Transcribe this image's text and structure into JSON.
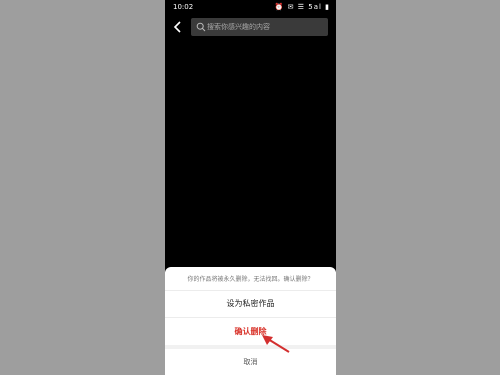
{
  "status_bar": {
    "time": "10:02",
    "icons_text": "⏰ ✉ ☰ 5al ▮"
  },
  "nav": {
    "back_icon": "chevron-left",
    "search_placeholder": "搜索你感兴趣的内容"
  },
  "sheet": {
    "message": "你的作品将被永久删除，无法找回。确认删除？",
    "option_private": "设为私密作品",
    "option_confirm": "确认删除",
    "option_cancel": "取消"
  },
  "colors": {
    "danger": "#d9342b",
    "annotation_arrow": "#d32f2f",
    "backdrop": "#9e9e9e"
  }
}
